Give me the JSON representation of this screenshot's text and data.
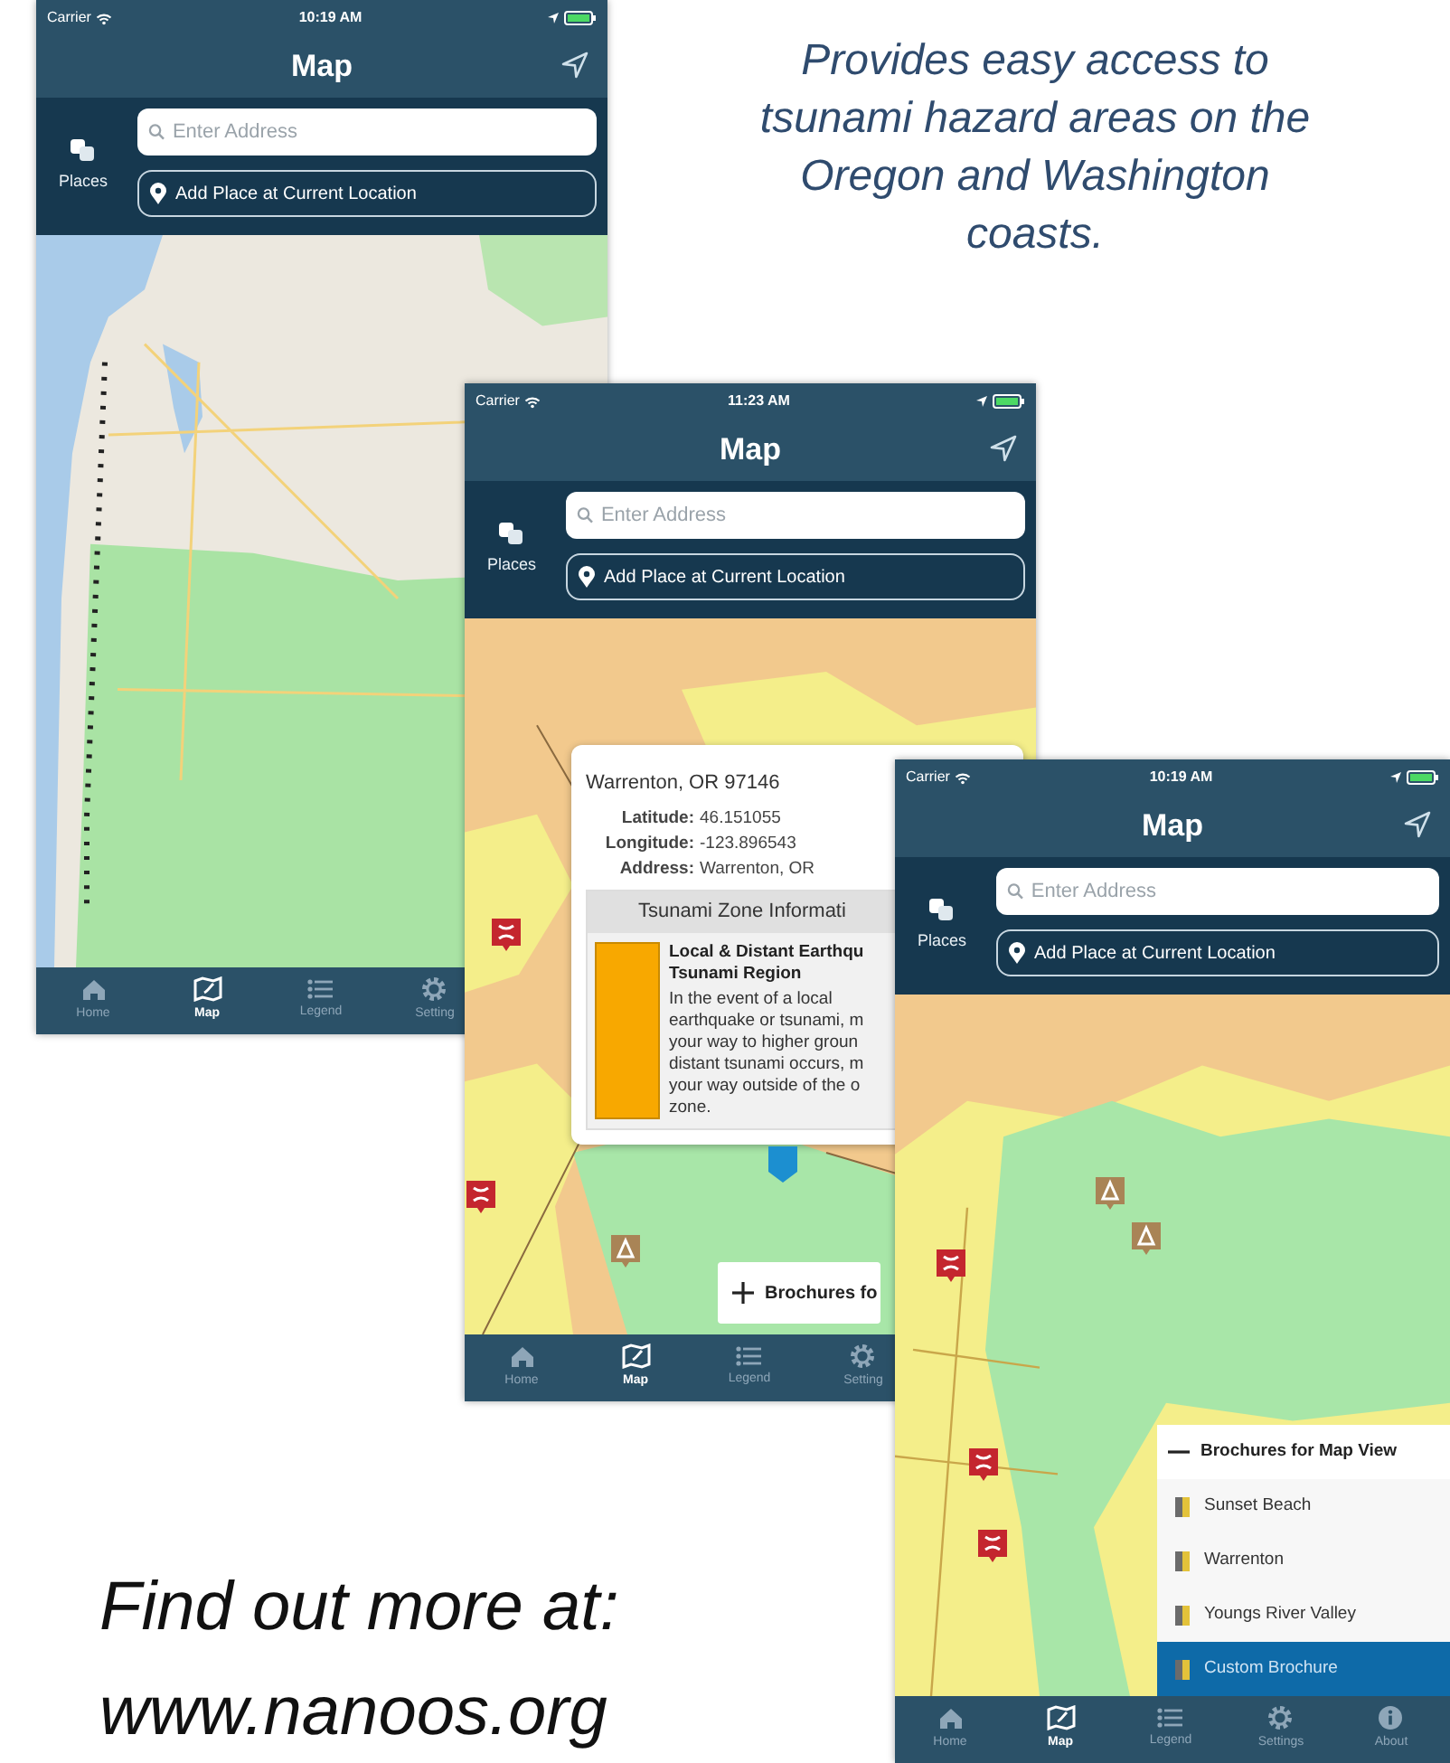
{
  "caption": "Provides easy access to tsunami hazard areas on the Oregon and Washington coasts.",
  "screens": [
    {
      "status": {
        "carrier": "Carrier",
        "time": "10:19 AM"
      },
      "title": "Map",
      "places_label": "Places",
      "search": {
        "placeholder": "Enter Address"
      },
      "add_place": "Add Place at Current Location",
      "map": {
        "kind": "street"
      },
      "tabs": [
        {
          "label": "Home",
          "selected": false
        },
        {
          "label": "Map",
          "selected": true
        },
        {
          "label": "Legend",
          "selected": false
        },
        {
          "label": "Setting",
          "selected": false
        }
      ]
    },
    {
      "status": {
        "carrier": "Carrier",
        "time": "11:23 AM"
      },
      "title": "Map",
      "places_label": "Places",
      "search": {
        "placeholder": "Enter Address"
      },
      "add_place": "Add Place at Current Location",
      "map": {
        "kind": "hazard"
      },
      "popup": {
        "place": "Warrenton, OR  97146",
        "details": [
          {
            "label": "Latitude:",
            "value": "46.151055"
          },
          {
            "label": "Longitude:",
            "value": "-123.896543"
          },
          {
            "label": "Address:",
            "value": "Warrenton, OR"
          }
        ],
        "zone_header": "Tsunami Zone Informati",
        "zone": {
          "color": "#f8a800",
          "name": "Local & Distant Earthqu\nTsunami Region",
          "text": "In the event of a local\nearthquake or tsunami, m\nyour way to higher groun\ndistant tsunami occurs, m\nyour way outside of the o\nzone."
        }
      },
      "brochures": {
        "title": "Brochures fo",
        "expanded": false
      },
      "tabs": [
        {
          "label": "Home",
          "selected": false
        },
        {
          "label": "Map",
          "selected": true
        },
        {
          "label": "Legend",
          "selected": false
        },
        {
          "label": "Setting",
          "selected": false
        }
      ]
    },
    {
      "status": {
        "carrier": "Carrier",
        "time": "10:19 AM"
      },
      "title": "Map",
      "places_label": "Places",
      "search": {
        "placeholder": "Enter Address"
      },
      "add_place": "Add Place at Current Location",
      "map": {
        "kind": "hazard2"
      },
      "brochures": {
        "title": "Brochures for Map View",
        "expanded": true,
        "items": [
          {
            "label": "Sunset Beach",
            "selected": false
          },
          {
            "label": "Warrenton",
            "selected": false
          },
          {
            "label": "Youngs River Valley",
            "selected": false
          },
          {
            "label": "Custom Brochure",
            "selected": true
          }
        ]
      },
      "tabs": [
        {
          "label": "Home",
          "selected": false
        },
        {
          "label": "Map",
          "selected": true
        },
        {
          "label": "Legend",
          "selected": false
        },
        {
          "label": "Settings",
          "selected": false
        },
        {
          "label": "About",
          "selected": false
        }
      ]
    }
  ],
  "footer": [
    "Find out more at:",
    "www.nanoos.org"
  ]
}
